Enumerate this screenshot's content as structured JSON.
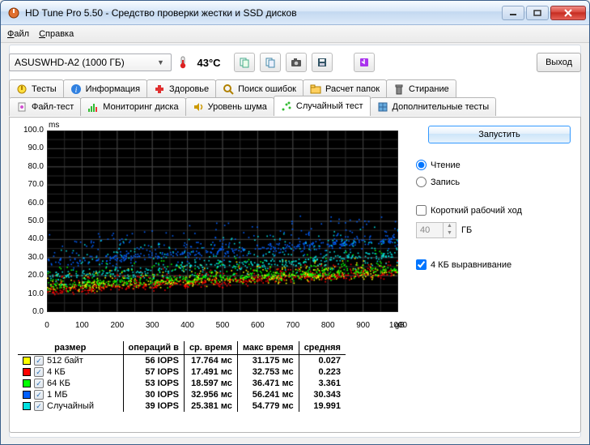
{
  "window": {
    "title": "HD Tune Pro 5.50 - Средство проверки жестки и SSD дисков"
  },
  "menu": {
    "file": "Файл",
    "help": "Справка"
  },
  "toolbar": {
    "drive": "ASUSWHD-A2 (1000 ГБ)",
    "temp": "43°C",
    "exit": "Выход"
  },
  "tabs": {
    "row1": [
      "Тесты",
      "Информация",
      "Здоровье",
      "Поиск ошибок",
      "Расчет папок",
      "Стирание"
    ],
    "row2": [
      "Файл-тест",
      "Мониторинг диска",
      "Уровень шума",
      "Случайный тест",
      "Дополнительные тесты"
    ],
    "active": "Случайный тест"
  },
  "side": {
    "run": "Запустить",
    "read": "Чтение",
    "write": "Запись",
    "short_cycle": "Короткий рабочий ход",
    "gb_value": "40",
    "gb_unit": "ГБ",
    "align": "4 КБ выравнивание"
  },
  "table": {
    "headers": [
      "размер",
      "операций в",
      "ср. время",
      "макс время",
      "средняя"
    ],
    "rows": [
      {
        "color": "#ffff00",
        "size": "512 байт",
        "iops": "56 IOPS",
        "avg": "17.764 мс",
        "max": "31.175 мс",
        "mean": "0.027"
      },
      {
        "color": "#ff0000",
        "size": "4 КБ",
        "iops": "57 IOPS",
        "avg": "17.491 мс",
        "max": "32.753 мс",
        "mean": "0.223"
      },
      {
        "color": "#00ff00",
        "size": "64 КБ",
        "iops": "53 IOPS",
        "avg": "18.597 мс",
        "max": "36.471 мс",
        "mean": "3.361"
      },
      {
        "color": "#0060ff",
        "size": "1 МБ",
        "iops": "30 IOPS",
        "avg": "32.956 мс",
        "max": "56.241 мс",
        "mean": "30.343"
      },
      {
        "color": "#00e0e0",
        "size": "Случайный",
        "iops": "39 IOPS",
        "avg": "25.381 мс",
        "max": "54.779 мс",
        "mean": "19.991"
      }
    ]
  },
  "chart_data": {
    "type": "scatter",
    "xlabel": "",
    "ylabel": "",
    "x_unit": "gB",
    "y_unit": "ms",
    "xlim": [
      0,
      1000
    ],
    "ylim": [
      0,
      100
    ],
    "x_ticks": [
      0,
      100,
      200,
      300,
      400,
      500,
      600,
      700,
      800,
      900,
      1000
    ],
    "y_ticks": [
      0,
      10,
      20,
      30,
      40,
      50,
      60,
      70,
      80,
      90,
      100
    ],
    "series": [
      {
        "name": "512 байт",
        "color": "#ffff00",
        "y_center_start": 14,
        "y_center_end": 22,
        "spread": 10,
        "count": 500
      },
      {
        "name": "4 КБ",
        "color": "#ff0000",
        "y_center_start": 12,
        "y_center_end": 22,
        "spread": 9,
        "count": 500
      },
      {
        "name": "64 КБ",
        "color": "#00ff00",
        "y_center_start": 15,
        "y_center_end": 24,
        "spread": 12,
        "count": 500
      },
      {
        "name": "1 МБ",
        "color": "#0060ff",
        "y_center_start": 28,
        "y_center_end": 40,
        "spread": 18,
        "count": 500
      },
      {
        "name": "Случайный",
        "color": "#00e0e0",
        "y_center_start": 20,
        "y_center_end": 32,
        "spread": 20,
        "count": 500
      }
    ]
  }
}
